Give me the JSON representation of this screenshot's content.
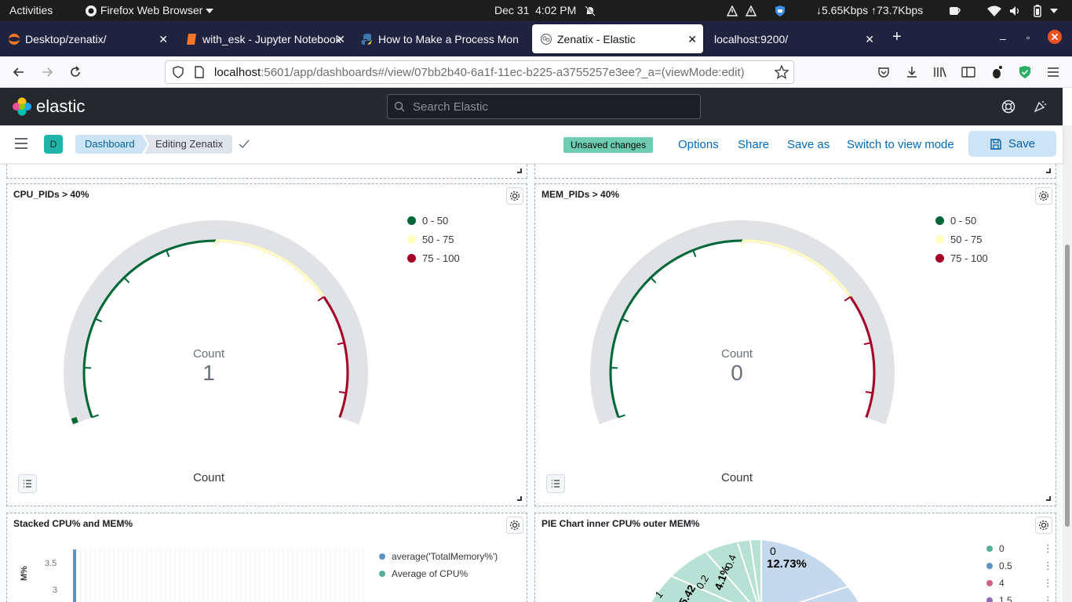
{
  "system_bar": {
    "activities": "Activities",
    "app_name": "Firefox Web Browser",
    "date": "Dec 31",
    "time": "4:02 PM",
    "network_speed": "↓5.65Kbps ↑73.7Kbps"
  },
  "tabs": [
    {
      "title": "Desktop/zenatix/",
      "active": false
    },
    {
      "title": "with_esk - Jupyter Notebook",
      "active": false
    },
    {
      "title": "How to Make a Process Monitor",
      "active": false
    },
    {
      "title": "Zenatix - Elastic",
      "active": true
    },
    {
      "title": "localhost:9200/",
      "active": false
    }
  ],
  "urlbar": {
    "host": "localhost",
    "rest": ":5601/app/dashboards#/view/07bb2b40-6a1f-11ec-b225-a3755257e3ee?_a=(viewMode:edit)"
  },
  "kibana": {
    "logo_text": "elastic",
    "search_placeholder": "Search Elastic"
  },
  "toolbar": {
    "avatar_letter": "D",
    "breadcrumb_dashboard": "Dashboard",
    "breadcrumb_current": "Editing Zenatix",
    "unsaved_badge": "Unsaved changes",
    "options": "Options",
    "share": "Share",
    "save_as": "Save as",
    "switch_mode": "Switch to view mode",
    "save": "Save"
  },
  "colors": {
    "range_low": "#006837",
    "range_mid": "#ffffbf",
    "range_high": "#a50026",
    "gauge_bg": "#e0e2e6",
    "series_memory": "#6092c0",
    "series_cpu": "#54b399"
  },
  "panels": {
    "cpu_gauge": {
      "title": "CPU_PIDs > 40%",
      "label": "Count",
      "value": "1",
      "caption": "Count",
      "legend": [
        "0 - 50",
        "50 - 75",
        "75 - 100"
      ]
    },
    "mem_gauge": {
      "title": "MEM_PIDs > 40%",
      "label": "Count",
      "value": "0",
      "caption": "Count",
      "legend": [
        "0 - 50",
        "50 - 75",
        "75 - 100"
      ]
    },
    "stacked": {
      "title": "Stacked CPU% and MEM%",
      "y_ticks": [
        "3.5",
        "3"
      ],
      "y_axis_label": "M%",
      "legend": [
        "average('TotalMemory%')",
        "Average of CPU%"
      ]
    },
    "pie": {
      "title": "PIE Chart inner CPU% outer MEM%",
      "slice_labels": [
        {
          "name": "0",
          "pct": "12.73%"
        },
        {
          "name": "0.4",
          "pct": "4.1%"
        },
        {
          "name": "0.2",
          "pct": "5.42"
        },
        {
          "name": "1",
          "pct": ""
        }
      ],
      "legend": [
        "0",
        "0.5",
        "4",
        "1.5"
      ],
      "legend_colors": [
        "#54b399",
        "#6092c0",
        "#d36086",
        "#9170b8"
      ]
    }
  },
  "chart_data": [
    {
      "type": "gauge",
      "title": "CPU_PIDs > 40%",
      "metric": "Count",
      "value": 1,
      "ranges": [
        {
          "name": "0 - 50"
        },
        {
          "name": "50 - 75"
        },
        {
          "name": "75 - 100"
        }
      ],
      "ylim": [
        0,
        100
      ]
    },
    {
      "type": "gauge",
      "title": "MEM_PIDs > 40%",
      "metric": "Count",
      "value": 0,
      "ranges": [
        {
          "name": "0 - 50"
        },
        {
          "name": "50 - 75"
        },
        {
          "name": "75 - 100"
        }
      ],
      "ylim": [
        0,
        100
      ]
    }
  ]
}
